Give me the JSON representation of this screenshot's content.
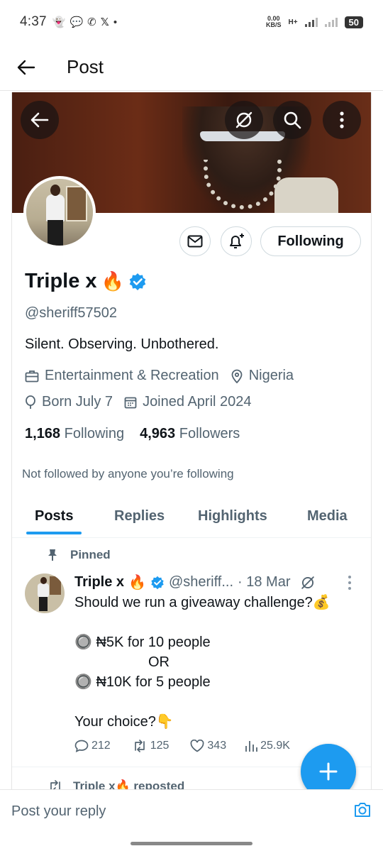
{
  "status_bar": {
    "time": "4:37",
    "net_speed_value": "0.00",
    "net_speed_unit": "KB/S",
    "network_type": "H+",
    "battery": "50"
  },
  "app_bar": {
    "title": "Post"
  },
  "profile": {
    "name": "Triple x",
    "name_emoji": "🔥",
    "handle": "@sheriff57502",
    "bio": "Silent. Observing. Unbothered.",
    "category": "Entertainment & Recreation",
    "location": "Nigeria",
    "born": "Born July 7",
    "joined": "Joined April 2024",
    "following_count": "1,168",
    "following_label": "Following",
    "followers_count": "4,963",
    "followers_label": "Followers",
    "not_followed": "Not followed by anyone you’re following",
    "follow_button": "Following"
  },
  "tabs": [
    "Posts",
    "Replies",
    "Highlights",
    "Media"
  ],
  "active_tab": "Posts",
  "pinned_post": {
    "pinned_label": "Pinned",
    "author_name": "Triple x",
    "author_emoji": "🔥",
    "author_handle": "@sheriff...",
    "date": "· 18 Mar",
    "lines": [
      "Should we run a giveaway challenge?💰",
      "",
      "🔘 ₦5K for 10 people",
      "OR",
      "🔘 ₦10K for 5 people",
      "",
      "Your choice?👇"
    ],
    "replies": "212",
    "reposts": "125",
    "likes": "343",
    "views": "25.9K"
  },
  "next_post": {
    "reposted_label": "Triple x🔥 reposted"
  },
  "reply_bar": {
    "placeholder": "Post your reply"
  },
  "colors": {
    "accent": "#1d9bf0",
    "text": "#0f1419",
    "muted": "#536471",
    "border": "#cfd9de"
  },
  "icons": [
    "back-arrow-icon",
    "grok-icon",
    "search-icon",
    "more-vertical-icon",
    "mail-icon",
    "bell-plus-icon",
    "verified-badge-icon",
    "briefcase-icon",
    "location-pin-icon",
    "balloon-icon",
    "calendar-icon",
    "pin-icon",
    "reply-icon",
    "repost-icon",
    "like-icon",
    "views-icon",
    "compose-plus-icon",
    "camera-icon"
  ]
}
